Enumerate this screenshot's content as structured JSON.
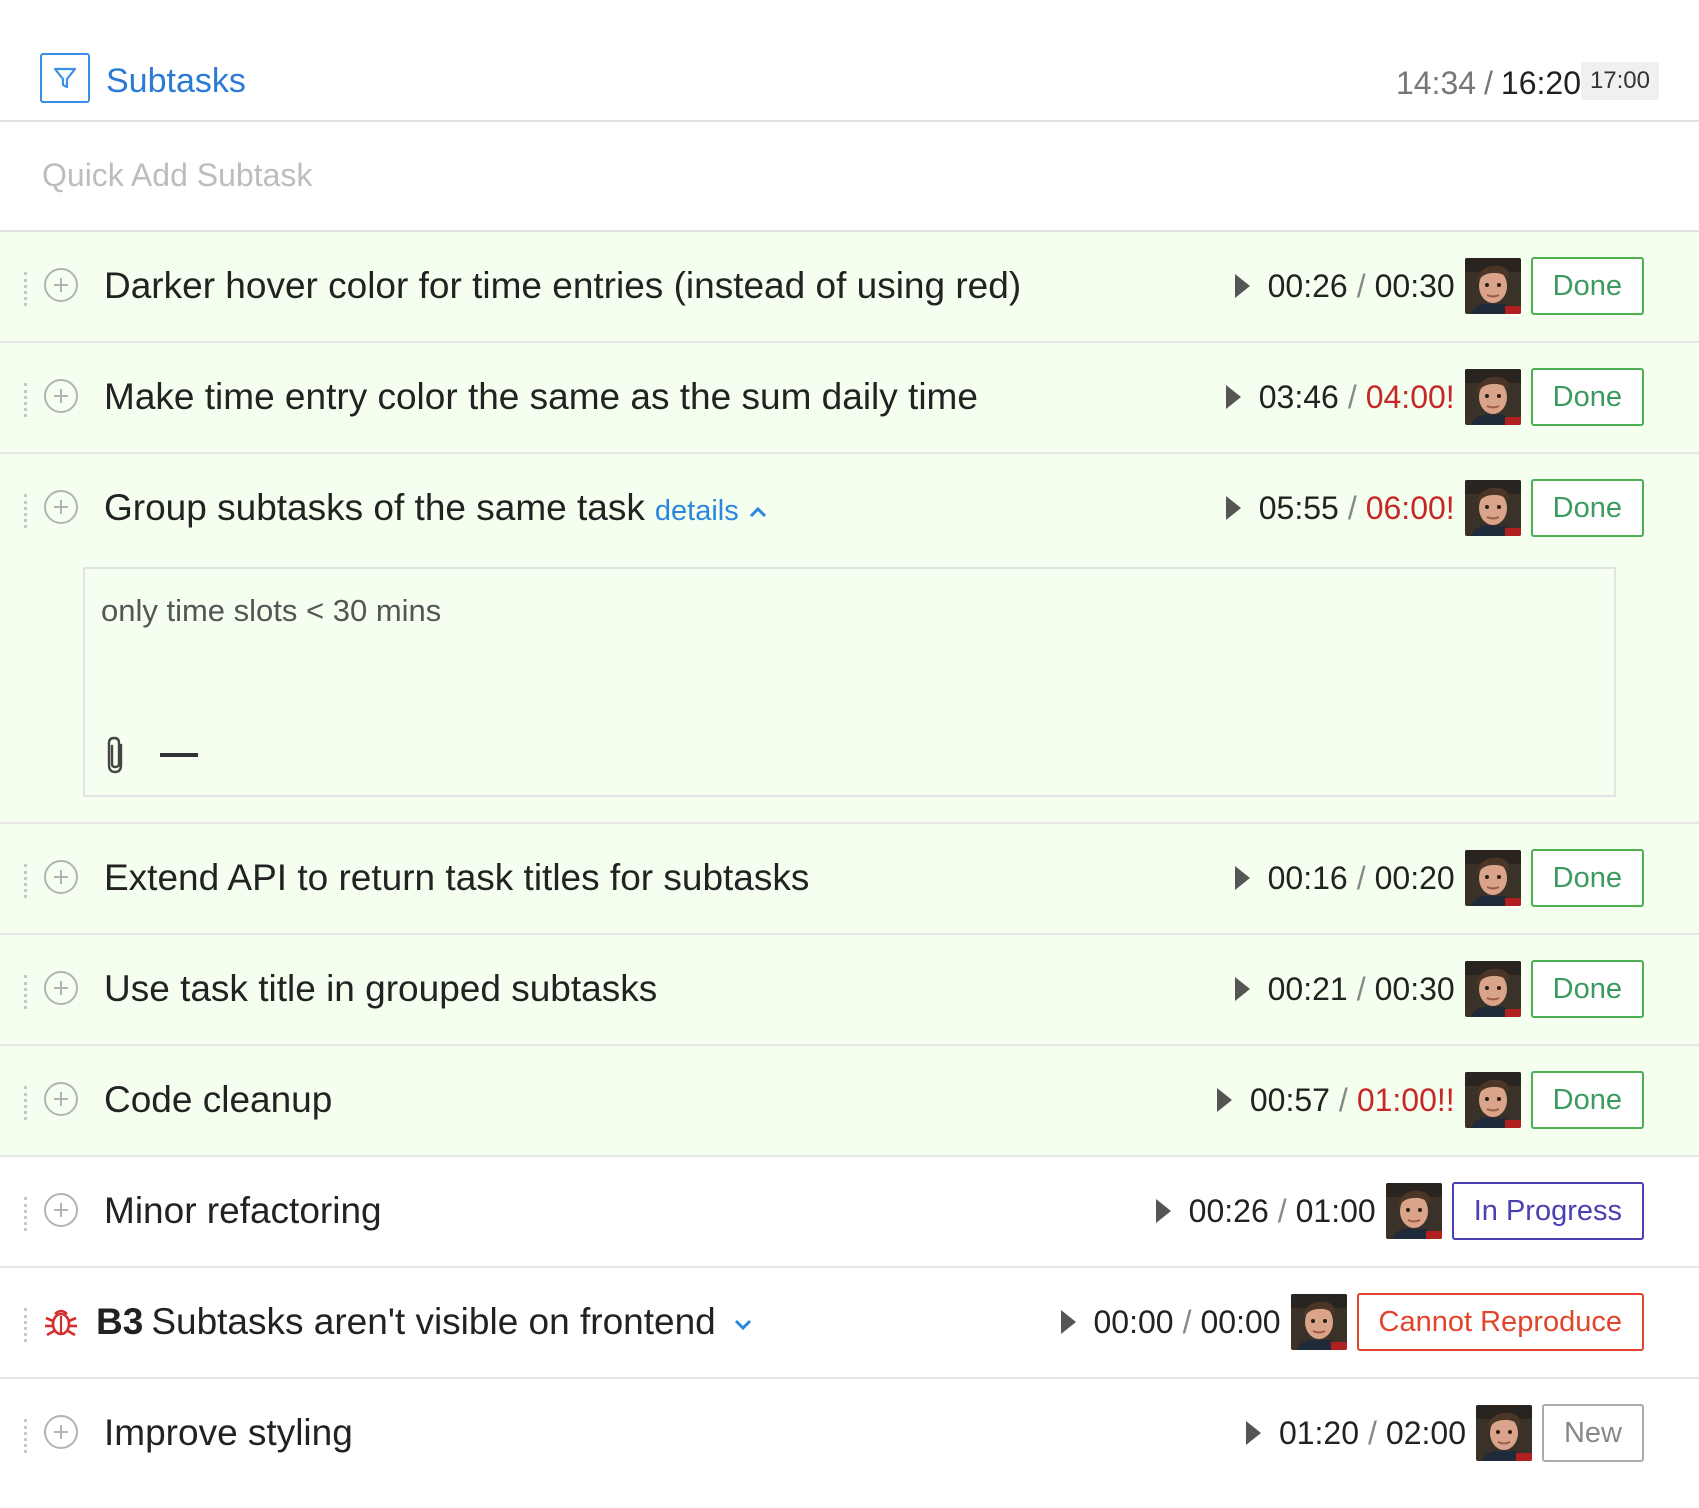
{
  "header": {
    "title": "Subtasks",
    "time_spent": "14:34",
    "separator": "/",
    "time_estimate": "16:20",
    "time_limit": "17:00"
  },
  "quick_add": {
    "placeholder": "Quick Add Subtask"
  },
  "colors": {
    "accent": "#2b7bd6",
    "done_row_bg": "#f5fff0",
    "over_estimate": "#c62828",
    "status_done": "#4caf50",
    "status_in_progress": "#4a3fb3",
    "status_cannot_reproduce": "#e0452a",
    "status_new": "#aaaaaa"
  },
  "subtasks": [
    {
      "title": "Darker hover color for time entries (instead of using red)",
      "spent": "00:26",
      "sep": "/",
      "estimate": "00:30",
      "status": "Done"
    },
    {
      "title": "Make time entry color the same as the sum daily time",
      "spent": "03:46",
      "sep": "/",
      "estimate": "04:00!",
      "status": "Done"
    },
    {
      "title": "Group subtasks of the same task",
      "details_label": "details",
      "spent": "05:55",
      "sep": "/",
      "estimate": "06:00!",
      "status": "Done",
      "details_text": "only time slots < 30 mins"
    },
    {
      "title": "Extend API to return task titles for subtasks",
      "spent": "00:16",
      "sep": "/",
      "estimate": "00:20",
      "status": "Done"
    },
    {
      "title": "Use task title in grouped subtasks",
      "spent": "00:21",
      "sep": "/",
      "estimate": "00:30",
      "status": "Done"
    },
    {
      "title": "Code cleanup",
      "spent": "00:57",
      "sep": "/",
      "estimate": "01:00!!",
      "status": "Done"
    },
    {
      "title": "Minor refactoring",
      "spent": "00:26",
      "sep": "/",
      "estimate": "01:00",
      "status": "In Progress"
    },
    {
      "key": "B3",
      "title": "Subtasks aren't visible on frontend",
      "spent": "00:00",
      "sep": "/",
      "estimate": "00:00",
      "status": "Cannot Reproduce"
    },
    {
      "title": "Improve styling",
      "spent": "01:20",
      "sep": "/",
      "estimate": "02:00",
      "status": "New"
    }
  ]
}
